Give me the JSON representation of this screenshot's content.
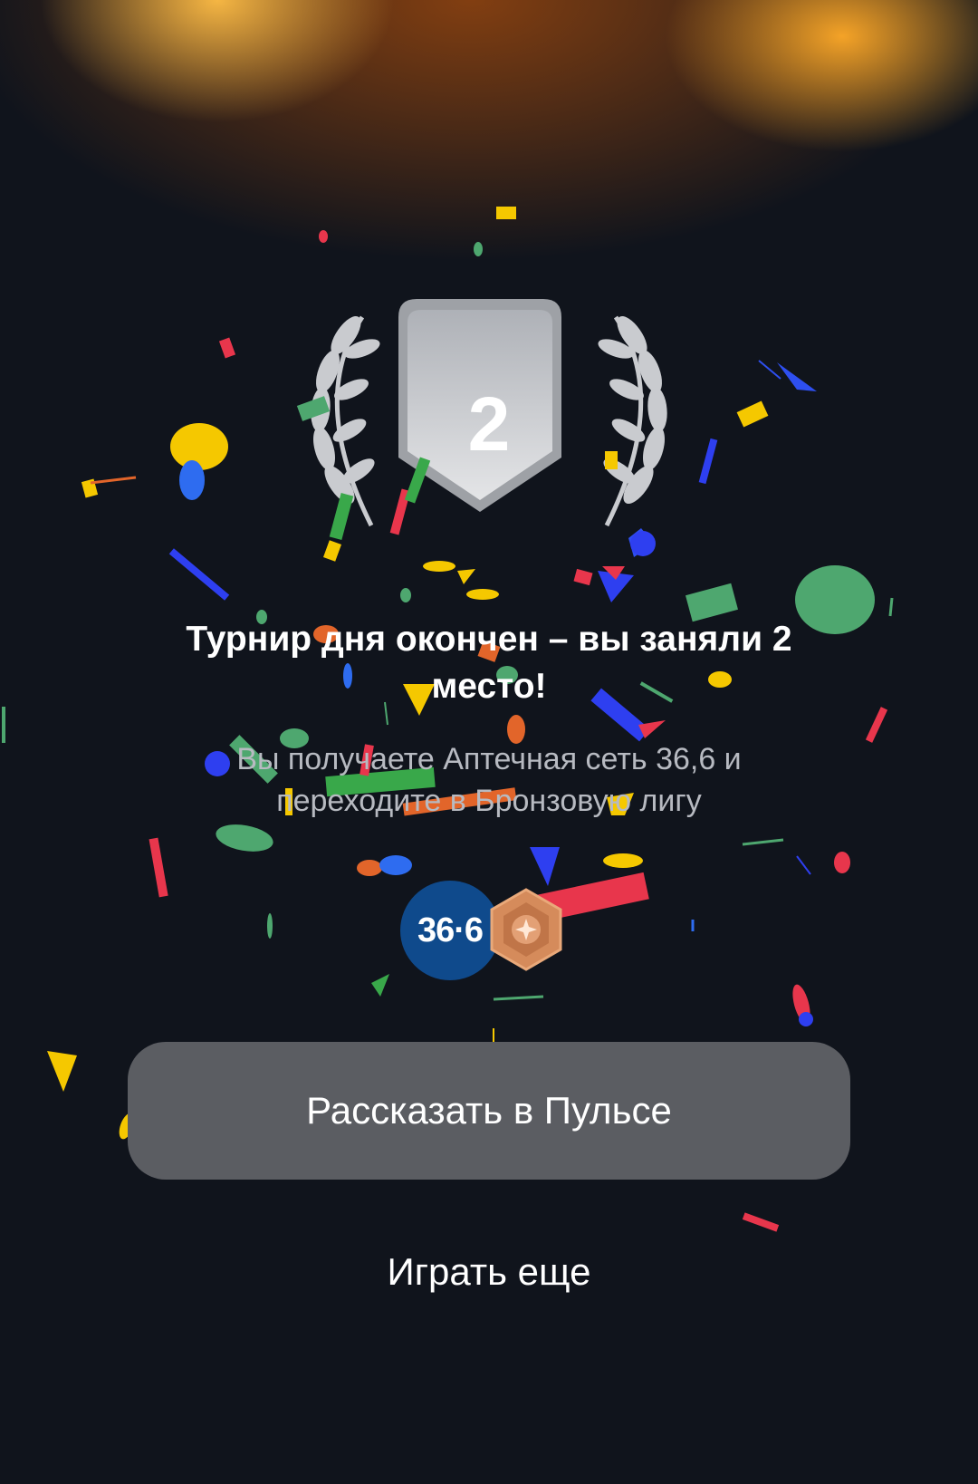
{
  "medal": {
    "place": "2"
  },
  "result": {
    "title": "Турнир дня окончен – вы заняли 2 место!",
    "subtitle": "Вы получаете Аптечная сеть 36,6 и переходите в Бронзовую лигу"
  },
  "prize": {
    "logo_text": "36·6",
    "league_icon": "bronze-league-badge-icon"
  },
  "actions": {
    "share_label": "Рассказать в Пульсе",
    "play_again_label": "Играть еще"
  },
  "colors": {
    "background": "#10141c",
    "button": "#5b5d62",
    "prize_logo": "#0f4a8c",
    "bronze": "#d58b5b"
  }
}
